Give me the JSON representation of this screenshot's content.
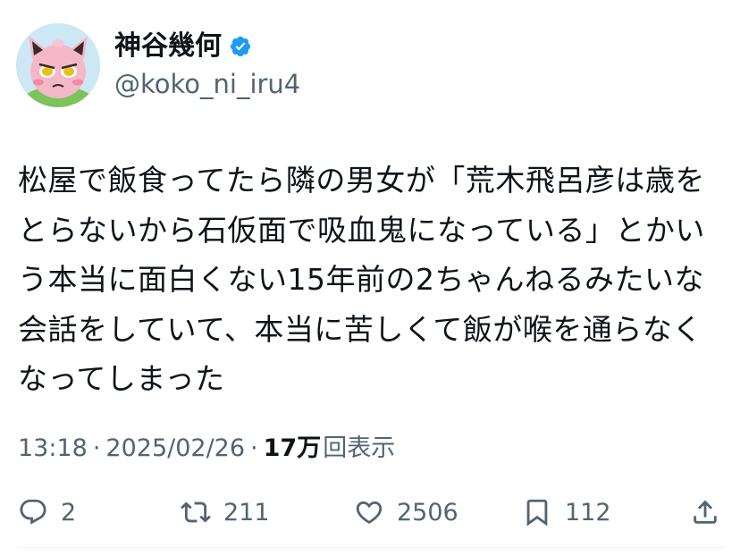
{
  "author": {
    "display_name": "神谷幾何",
    "handle": "@koko_ni_iru4",
    "verified": true,
    "avatar_icon": "pink-creature-avatar-icon"
  },
  "tweet": {
    "text": "松屋で飯食ってたら隣の男女が「荒木飛呂彦は歳を\nとらないから石仮面で吸血鬼になっている」とかい\nう本当に面白くない15年前の2ちゃんねるみたいな\n会話をしていて、本当に苦しくて飯が喉を通らなく\nなってしまった"
  },
  "meta": {
    "time": "13:18",
    "separator": "·",
    "date": "2025/02/26",
    "views": "17万",
    "views_label": "回表示"
  },
  "actions": {
    "reply_count": "2",
    "retweet_count": "211",
    "like_count": "2506",
    "bookmark_count": "112"
  },
  "colors": {
    "text": "#0f1419",
    "secondary": "#536471",
    "verified": "#1d9bf0"
  }
}
